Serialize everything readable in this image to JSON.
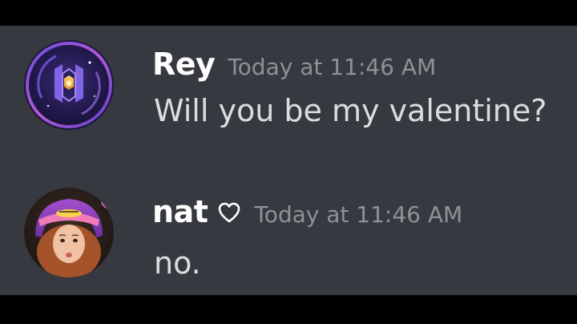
{
  "messages": [
    {
      "username": "Rey",
      "timestamp": "Today at 11:46 AM",
      "text": "Will you be my valentine?",
      "avatar_icon": "rey-logo-avatar"
    },
    {
      "username": "nat",
      "badge_icon": "heart-outline-icon",
      "timestamp": "Today at 11:46 AM",
      "text": "no.",
      "avatar_icon": "nat-photo-avatar"
    }
  ],
  "colors": {
    "background": "#36393f",
    "username": "#ffffff",
    "timestamp": "#8e9297",
    "message_text": "#dcddde",
    "letterbox": "#000000"
  }
}
